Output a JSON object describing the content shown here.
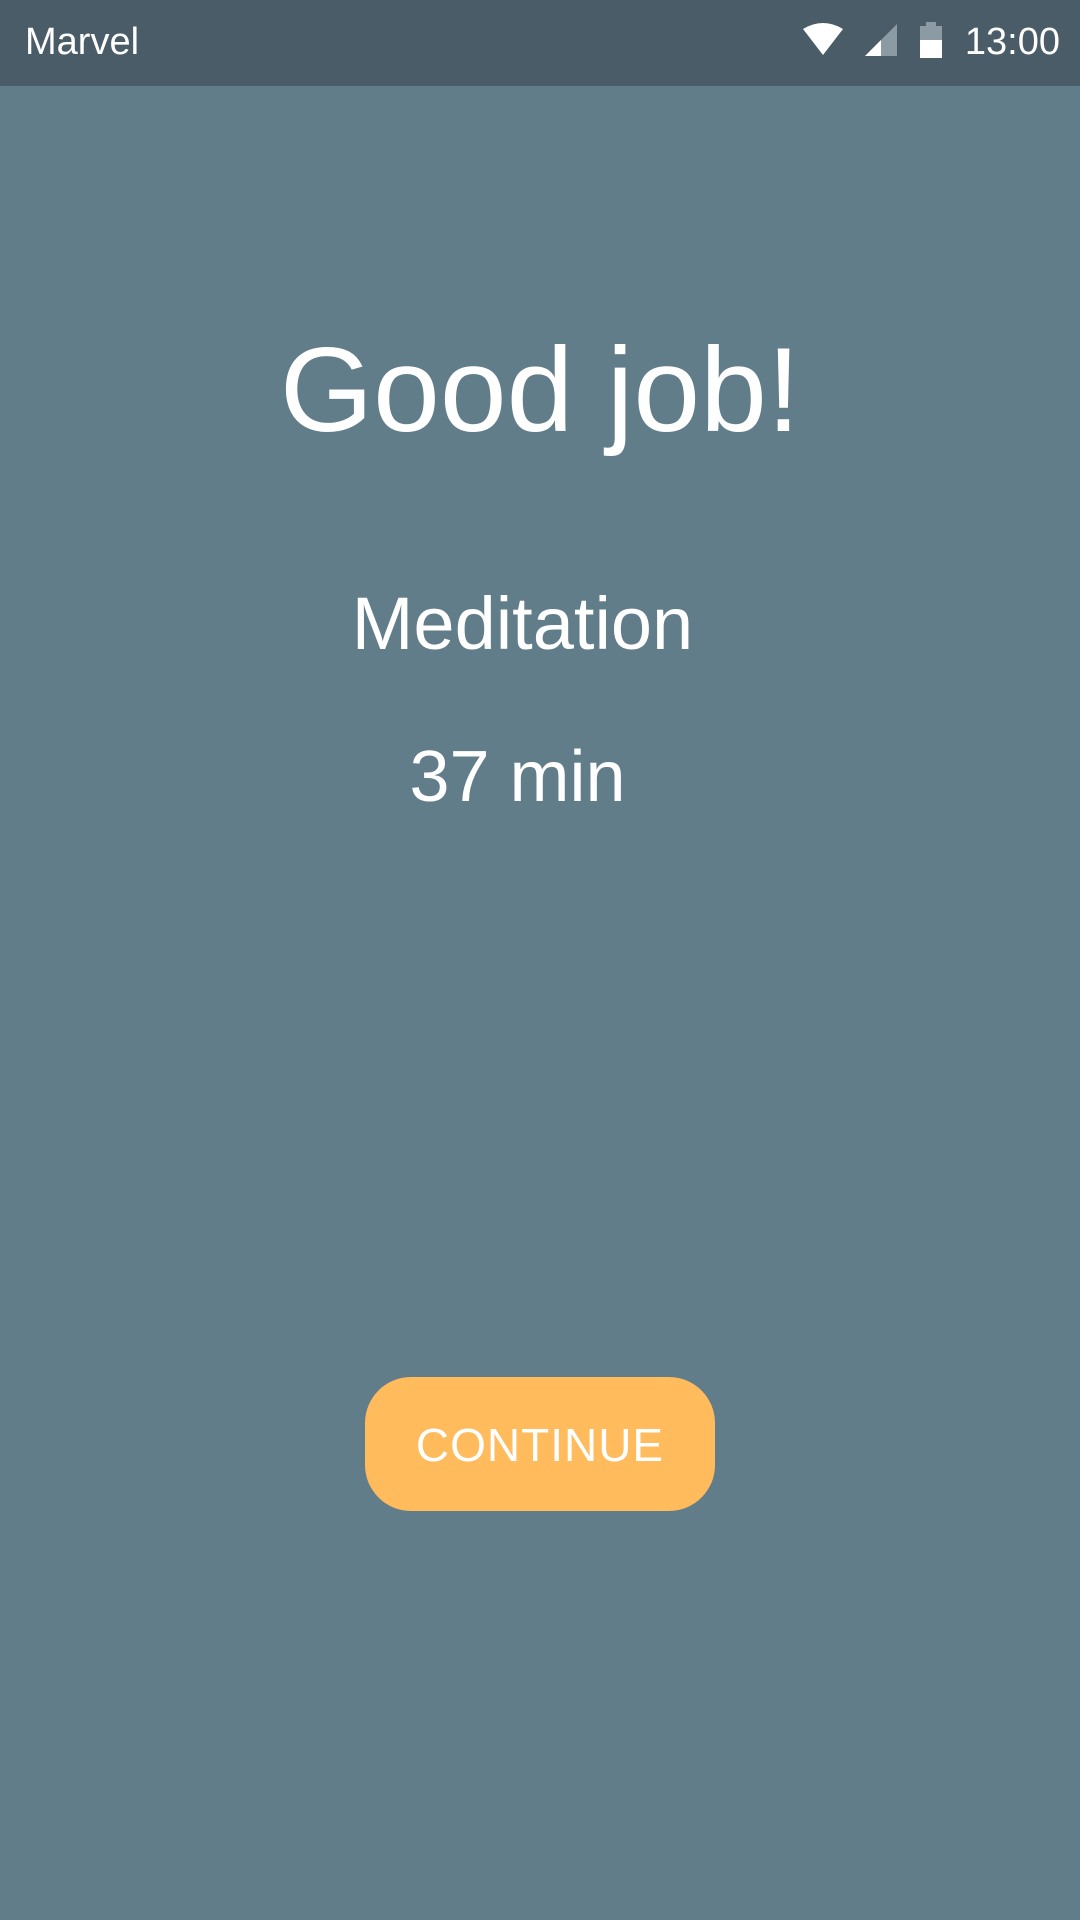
{
  "status_bar": {
    "app_name": "Marvel",
    "time": "13:00",
    "icons": [
      "wifi-icon",
      "cell-signal-icon",
      "battery-icon"
    ]
  },
  "main": {
    "headline": "Good job!",
    "activity": "Meditation",
    "duration": "37 min"
  },
  "actions": {
    "continue_label": "CONTINUE"
  },
  "colors": {
    "background": "#627d8a",
    "status_bar": "#4a5c67",
    "button": "#ffbb5c",
    "text": "#ffffff"
  }
}
